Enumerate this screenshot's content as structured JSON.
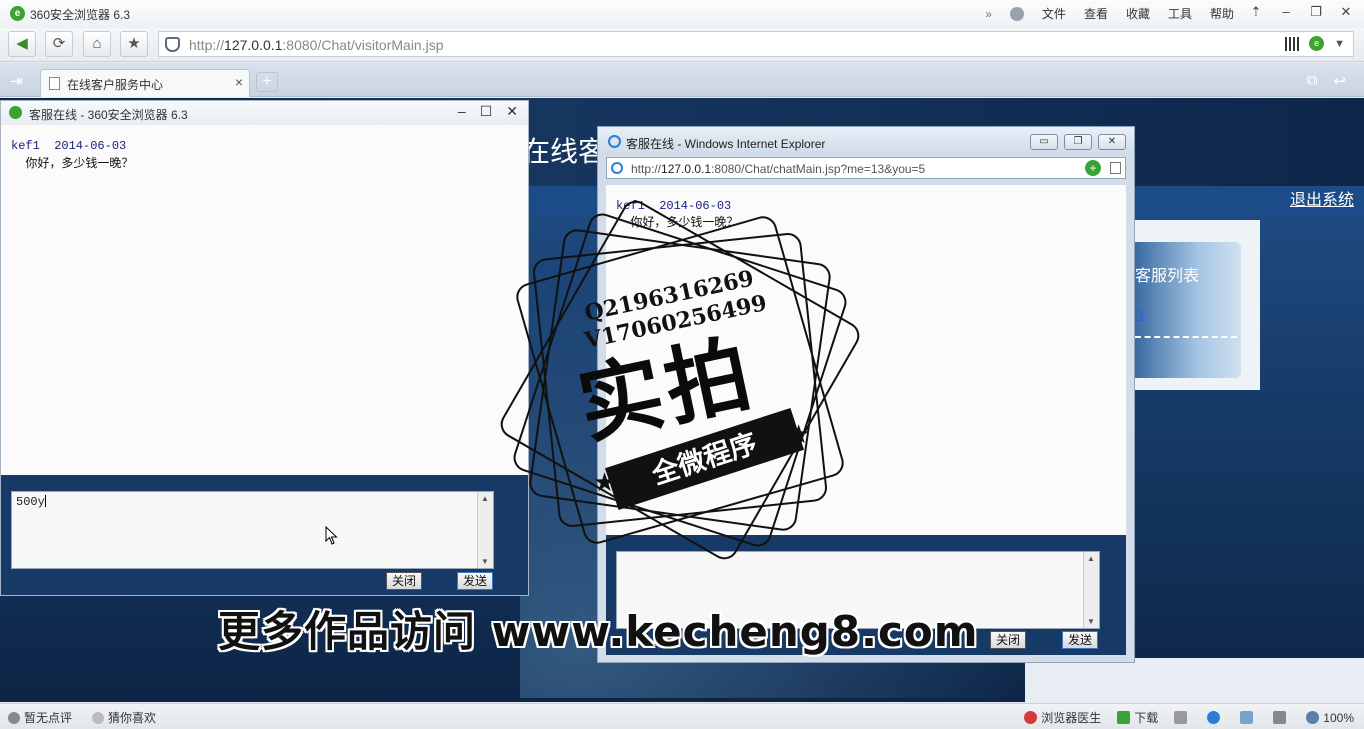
{
  "browser": {
    "title": "360安全浏览器 6.3",
    "menu": [
      "文件",
      "查看",
      "收藏",
      "工具",
      "帮助"
    ],
    "address": {
      "prefix": "http://",
      "host": "127.0.0.1",
      "rest": ":8080/Chat/visitorMain.jsp"
    },
    "tab": {
      "label": "在线客户服务中心"
    }
  },
  "visitor_page": {
    "title_fragment": "在线客",
    "logout": "退出系统",
    "service_list_title": "客服列表",
    "service_link": "1"
  },
  "chat360": {
    "title": "客服在线 - 360安全浏览器 6.3",
    "message_head": "kef1  2014-06-03",
    "message_body": "  你好，多少钱一晚？",
    "input_value": "500y",
    "close_label": "关闭",
    "send_label": "发送"
  },
  "chatIE": {
    "title": "客服在线 - Windows Internet Explorer",
    "address": {
      "prefix": "http://",
      "host": "127.0.0.1",
      "rest": ":8080/Chat/chatMain.jsp?me=13&you=5"
    },
    "message_head": "kef1  2014-06-03",
    "message_body": "  你好，多少钱一晚？",
    "input_value": "",
    "close_label": "关闭",
    "send_label": "发送"
  },
  "watermark": {
    "qq": "Q2196316269",
    "vx": "V17060256499",
    "big": "实拍",
    "ribbon": "全微程序",
    "footer": "更多作品访问 www.kecheng8.com"
  },
  "statusbar": {
    "left": [
      "暂无点评",
      "猜你喜欢"
    ],
    "doctor": "浏览器医生",
    "download": "下载",
    "zoom": "100%"
  }
}
